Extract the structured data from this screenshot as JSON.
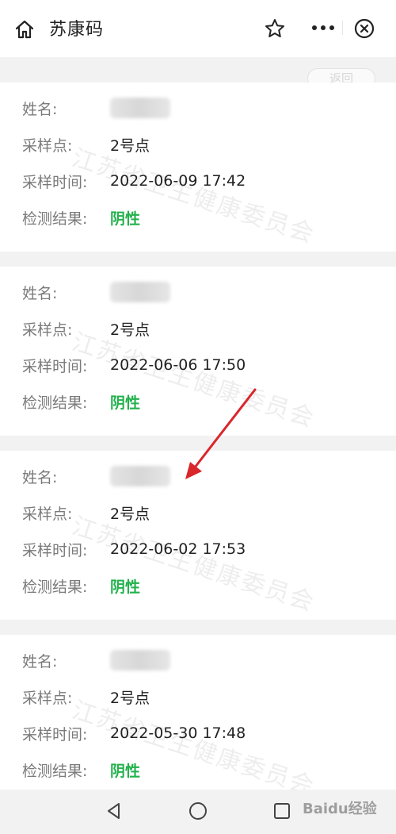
{
  "header": {
    "title": "苏康码"
  },
  "back_pill_label": "返回",
  "watermark_text": "江苏省卫生健康委员会",
  "labels": {
    "name": "姓名:",
    "site": "采样点:",
    "time": "采样时间:",
    "result": "检测结果:"
  },
  "records": [
    {
      "site": "2号点",
      "time": "2022-06-09 17:42",
      "result": "阴性"
    },
    {
      "site": "2号点",
      "time": "2022-06-06 17:50",
      "result": "阴性"
    },
    {
      "site": "2号点",
      "time": "2022-06-02 17:53",
      "result": "阴性"
    },
    {
      "site": "2号点",
      "time": "2022-05-30 17:48",
      "result": "阴性"
    }
  ],
  "corner_logo_text": "Baidu经验",
  "colors": {
    "result_negative": "#22b14c",
    "annotation_arrow": "#d9262c"
  }
}
